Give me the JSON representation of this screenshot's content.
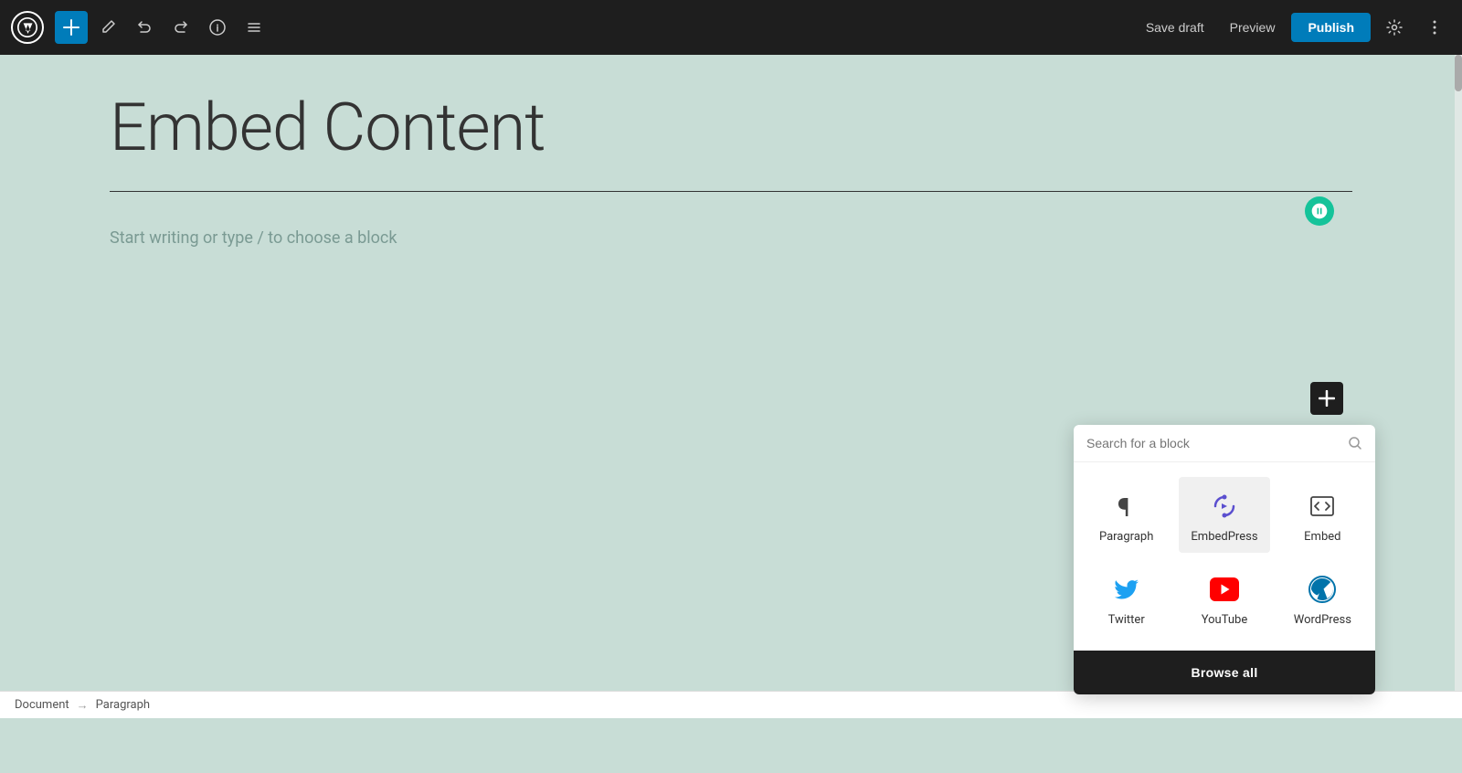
{
  "toolbar": {
    "add_label": "+",
    "save_draft_label": "Save draft",
    "preview_label": "Preview",
    "publish_label": "Publish"
  },
  "editor": {
    "post_title": "Embed Content",
    "placeholder": "Start writing or type / to choose a block"
  },
  "block_picker": {
    "search_placeholder": "Search for a block",
    "blocks": [
      {
        "id": "paragraph",
        "label": "Paragraph",
        "icon": "¶"
      },
      {
        "id": "embedpress",
        "label": "EmbedPress",
        "icon": "🔗"
      },
      {
        "id": "embed",
        "label": "Embed",
        "icon": "</>"
      },
      {
        "id": "twitter",
        "label": "Twitter",
        "icon": "🐦"
      },
      {
        "id": "youtube",
        "label": "YouTube",
        "icon": "▶"
      },
      {
        "id": "wordpress",
        "label": "WordPress",
        "icon": "W"
      }
    ],
    "browse_all_label": "Browse all"
  },
  "status_bar": {
    "document_label": "Document",
    "separator": "→",
    "context_label": "Paragraph"
  }
}
